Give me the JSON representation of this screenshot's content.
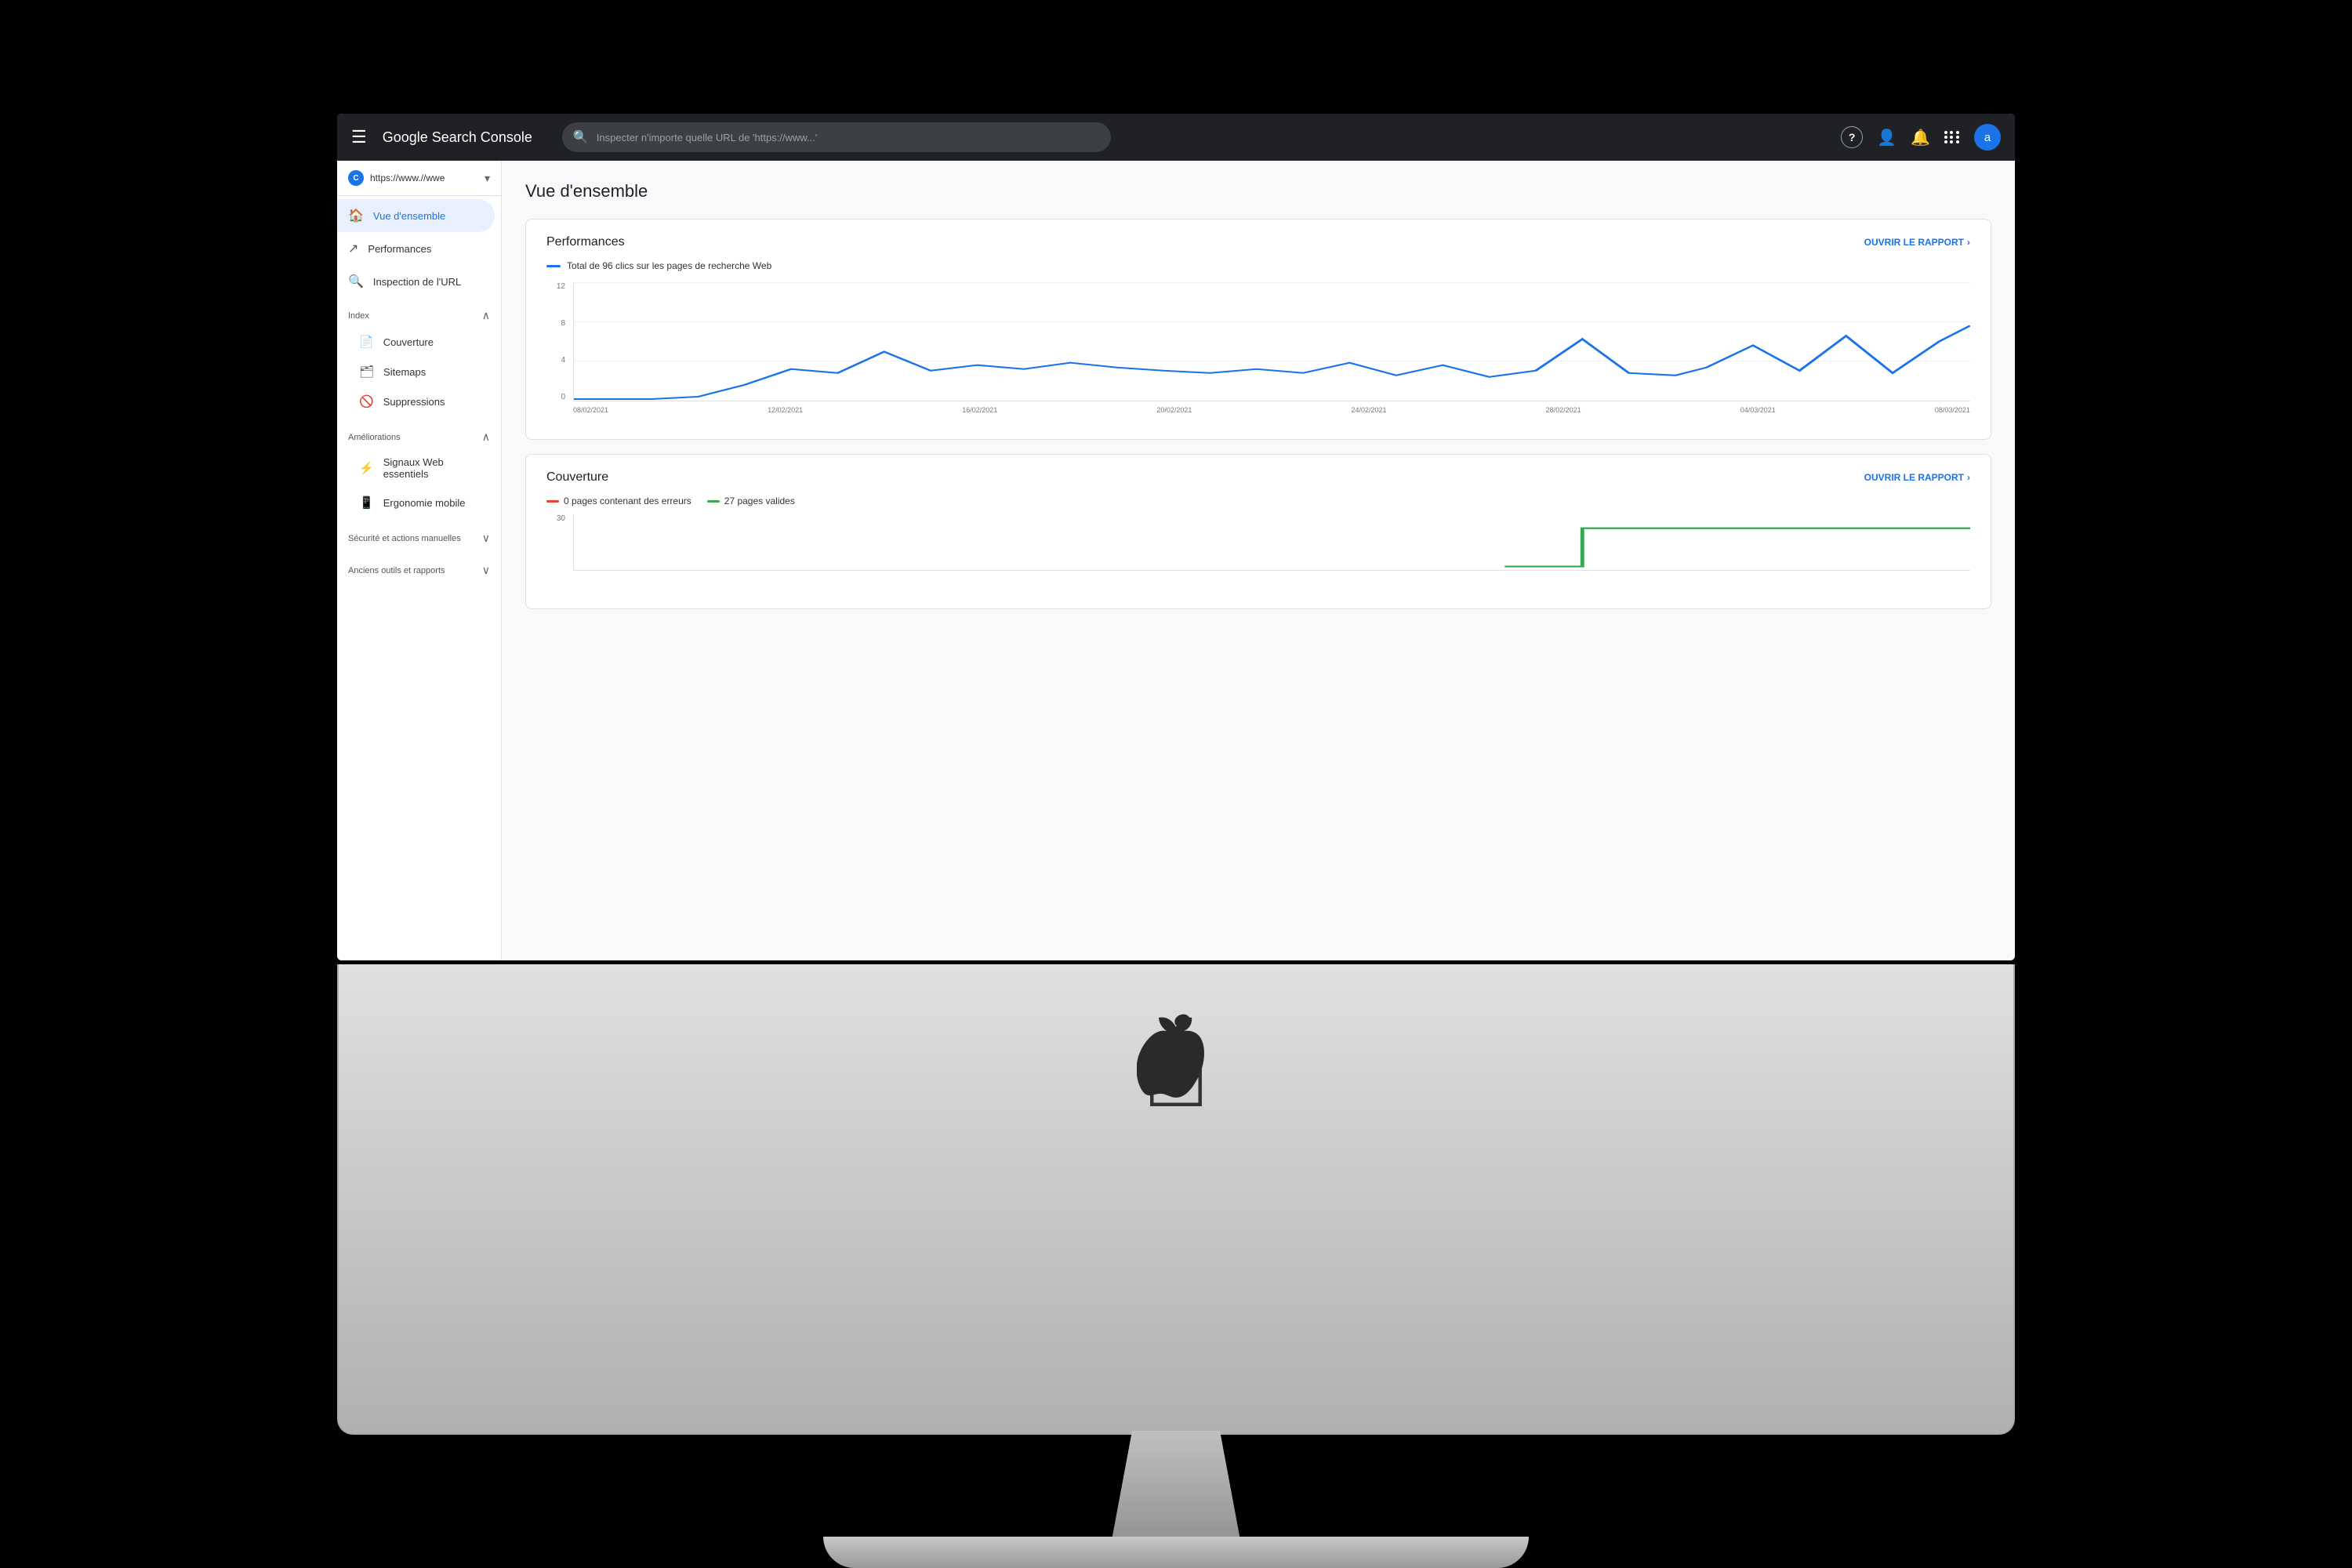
{
  "monitor": {
    "apple_logo": ""
  },
  "topbar": {
    "hamburger": "☰",
    "logo": "Google Search Console",
    "search_placeholder": "Inspecter n'importe quelle URL de 'https://www...'",
    "help_icon": "?",
    "user_icon": "👤",
    "bell_icon": "🔔",
    "grid_icon": "⋮⋮⋮",
    "avatar_letter": "a"
  },
  "sidebar": {
    "site_url": "https://www.//wwe",
    "nav_items": [
      {
        "label": "Vue d'ensemble",
        "icon": "🏠",
        "active": true
      },
      {
        "label": "Performances",
        "icon": "↗"
      },
      {
        "label": "Inspection de l'URL",
        "icon": "🔍"
      }
    ],
    "sections": [
      {
        "label": "Index",
        "items": [
          {
            "label": "Couverture",
            "icon": "📄"
          },
          {
            "label": "Sitemaps",
            "icon": "🗂"
          },
          {
            "label": "Suppressions",
            "icon": "🚫"
          }
        ]
      },
      {
        "label": "Améliorations",
        "items": [
          {
            "label": "Signaux Web essentiels",
            "icon": "⚡"
          },
          {
            "label": "Ergonomie mobile",
            "icon": "📱"
          }
        ]
      },
      {
        "label": "Sécurité et actions manuelles",
        "items": []
      },
      {
        "label": "Anciens outils et rapports",
        "items": []
      }
    ]
  },
  "content": {
    "page_title": "Vue d'ensemble",
    "performances_card": {
      "title": "Performances",
      "link": "OUVRIR LE RAPPORT",
      "legend": "Total de 96 clics sur les pages de recherche Web",
      "yaxis": [
        "12",
        "8",
        "4",
        "0"
      ],
      "xaxis": [
        "08/02/2021",
        "12/02/2021",
        "16/02/2021",
        "20/02/2021",
        "24/02/2021",
        "28/02/2021",
        "04/03/2021",
        "08/03/2021"
      ],
      "chart_color": "#1a73e8"
    },
    "coverage_card": {
      "title": "Couverture",
      "link": "OUVRIR LE RAPPORT",
      "legend_error": "0 pages contenant des erreurs",
      "legend_valid": "27 pages valides",
      "yaxis": [
        "30"
      ],
      "chart_color_green": "#34a853",
      "chart_color_red": "#ea4335"
    }
  }
}
